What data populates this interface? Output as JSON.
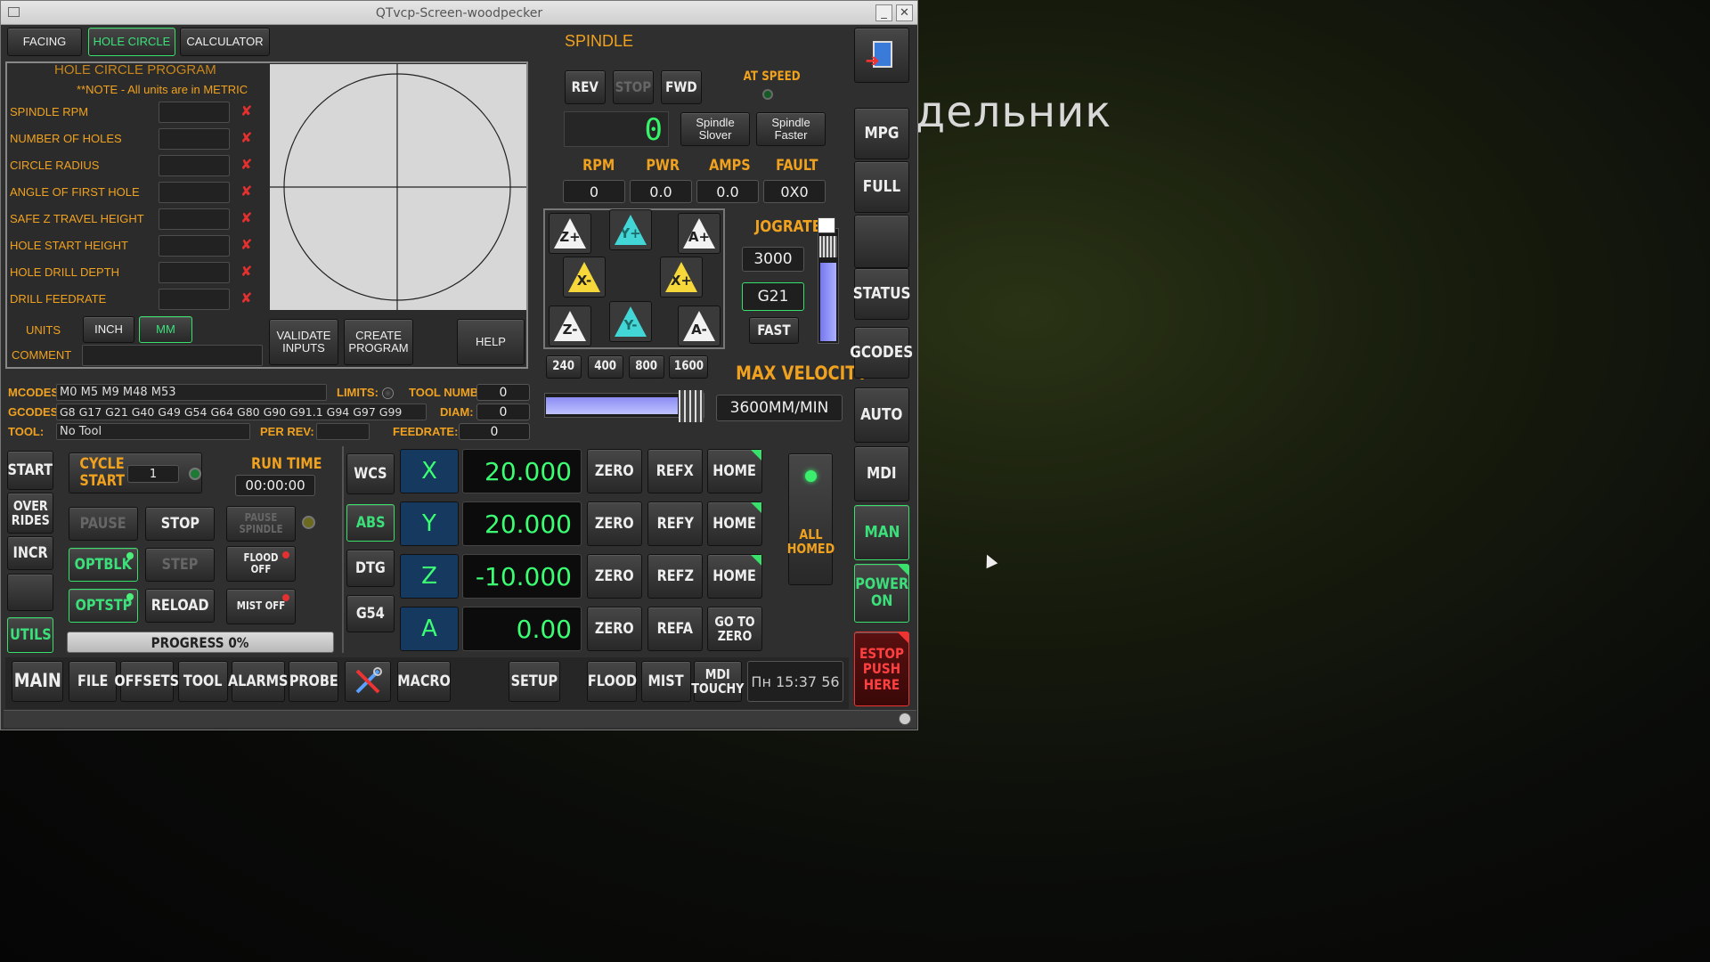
{
  "background": {
    "text": "дельник"
  },
  "window": {
    "title": "QTvcp-Screen-woodpecker",
    "min": "_",
    "close": "✕"
  },
  "tabs": [
    "FACING",
    "HOLE CIRCLE",
    "CALCULATOR"
  ],
  "hole": {
    "title": "HOLE CIRCLE PROGRAM",
    "note": "**NOTE - All units are in METRIC",
    "params": [
      "SPINDLE RPM",
      "NUMBER OF HOLES",
      "CIRCLE RADIUS",
      "ANGLE OF FIRST HOLE",
      "SAFE Z TRAVEL HEIGHT",
      "HOLE START HEIGHT",
      "HOLE DRILL DEPTH",
      "DRILL FEEDRATE"
    ],
    "units_label": "UNITS",
    "inch": "INCH",
    "mm": "MM",
    "comment_label": "COMMENT",
    "validate": "VALIDATE INPUTS",
    "create": "CREATE PROGRAM",
    "help": "HELP"
  },
  "spindle": {
    "title": "SPINDLE",
    "rev": "REV",
    "stop": "STOP",
    "fwd": "FWD",
    "atspeed": "AT SPEED",
    "speed": "0",
    "slower": "Spindle Slover",
    "faster": "Spindle Faster",
    "rpm_l": "RPM",
    "pwr_l": "PWR",
    "amps_l": "AMPS",
    "fault_l": "FAULT",
    "rpm": "0",
    "pwr": "0.0",
    "amps": "0.0",
    "fault": "0X0"
  },
  "jog": {
    "zp": "Z+",
    "yp": "Y+",
    "ap": "A+",
    "xm": "X-",
    "xp": "X+",
    "zm": "Z-",
    "ym": "Y-",
    "am": "A-",
    "jograte_l": "JOGRATE",
    "jograte": "3000",
    "g21": "G21",
    "fast": "FAST",
    "slider_pct": 70,
    "presets": [
      "240",
      "400",
      "800",
      "1600"
    ],
    "maxvel_l": "MAX VELOCITY",
    "maxvel": "3600MM/MIN"
  },
  "side": {
    "mpg": "MPG",
    "full": "FULL",
    "status": "STATUS",
    "gcodes": "GCODES",
    "auto": "AUTO",
    "mdi": "MDI",
    "man": "MAN",
    "power": "POWER ON",
    "estop": "ESTOP PUSH HERE"
  },
  "info": {
    "mcodes_l": "MCODES:",
    "mcodes": "M0 M5 M9 M48 M53",
    "limits_l": "LIMITS:",
    "toolnumb_l": "TOOL NUMB:",
    "toolnumb": "0",
    "gcodes_l": "GCODES:",
    "gcodes": "G8 G17 G21 G40 G49 G54 G64 G80 G90 G91.1 G94 G97 G99",
    "diam_l": "DIAM:",
    "diam": "0",
    "tool_l": "TOOL:",
    "tool": "No Tool",
    "perrev_l": "PER REV:",
    "feed_l": "FEEDRATE:",
    "feed": "0"
  },
  "run": {
    "start": "START",
    "overrides": "OVER RIDES",
    "incr": "INCR",
    "utils": "UTILS",
    "cycle": "CYCLE START",
    "cycle_val": "1",
    "runtime_l": "RUN TIME",
    "runtime": "00:00:00",
    "pause": "PAUSE",
    "stop": "STOP",
    "pause_sp": "PAUSE SPINDLE",
    "optblk": "OPTBLK",
    "step": "STEP",
    "flood_off": "FLOOD OFF",
    "optstp": "OPTSTP",
    "reload": "RELOAD",
    "mist_off": "MIST OFF",
    "progress": "PROGRESS 0%"
  },
  "dro": {
    "wcs": "WCS",
    "abs": "ABS",
    "dtg": "DTG",
    "g54": "G54",
    "axes": [
      {
        "n": "X",
        "v": "20.000",
        "ref": "REFX",
        "h": "HOME"
      },
      {
        "n": "Y",
        "v": "20.000",
        "ref": "REFY",
        "h": "HOME"
      },
      {
        "n": "Z",
        "v": "-10.000",
        "ref": "REFZ",
        "h": "HOME"
      },
      {
        "n": "A",
        "v": "0.00",
        "ref": "REFA",
        "h": "GO TO ZERO"
      }
    ],
    "zero": "ZERO",
    "allhomed": "ALL HOMED"
  },
  "bottom": {
    "tabs": [
      "MAIN",
      "FILE",
      "OFFSETS",
      "TOOL",
      "ALARMS",
      "PROBE"
    ],
    "macro": "MACRO",
    "setup": "SETUP",
    "flood": "FLOOD",
    "mist": "MIST",
    "mdi": "MDI TOUCHY",
    "clock": "Пн 15:37 56"
  }
}
